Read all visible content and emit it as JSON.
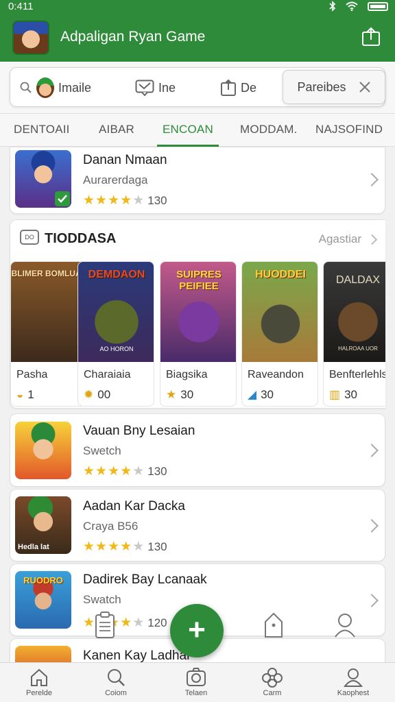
{
  "status": {
    "time": "0:411"
  },
  "header": {
    "title": "Adpaligan Ryan Game"
  },
  "filters": [
    {
      "label": "Imaile"
    },
    {
      "label": "Ine"
    },
    {
      "label": "De"
    },
    {
      "label": "Pareibes"
    }
  ],
  "tabs": [
    {
      "label": "DENTOAII",
      "active": false
    },
    {
      "label": "AIBAR",
      "active": false
    },
    {
      "label": "ENCOAN",
      "active": true
    },
    {
      "label": "MODDAM.",
      "active": false
    },
    {
      "label": "NAJSOFIND",
      "active": false
    }
  ],
  "top_game": {
    "name": "Danan Nmaan",
    "subtitle": "Aurarerdaga",
    "rating": 4,
    "count": "130"
  },
  "section": {
    "icon_text": "DO",
    "title": "TIODDASA",
    "link": "Agastiar",
    "tiles": [
      {
        "art_title": "BLIMER BOMLUAD",
        "caption": "Pasha",
        "score": "1",
        "icon": "lamp-icon"
      },
      {
        "art_title": "DEMDAON",
        "badge_text": "AO HORON",
        "caption": "Charaiaia",
        "score": "00",
        "icon": "sun-icon"
      },
      {
        "art_title": "SUIPRES PEIFIEE",
        "caption": "Biagsika",
        "score": "30",
        "icon": "star-icon"
      },
      {
        "art_title": "HUODDEI",
        "caption": "Raveandon",
        "score": "30",
        "icon": "bolt-icon"
      },
      {
        "art_title": "DALDAX",
        "badge_text": "HALROAA UOR",
        "caption": "Benfterlehls",
        "score": "30",
        "icon": "bars-icon"
      }
    ]
  },
  "games": [
    {
      "name": "Vauan Bny Lesaian",
      "subtitle": "Swetch",
      "rating": 4,
      "count": "130"
    },
    {
      "name": "Aadan Kar Dacka",
      "subtitle": "Craya B56",
      "rating": 4,
      "count": "130",
      "art_text": "Hedla lat"
    },
    {
      "name": "Dadirek Bay Lcanaak",
      "subtitle": "Swatch",
      "rating": 4,
      "count": "120",
      "art_text": "RUODRO"
    },
    {
      "name": "Kanen Kay Ladhar"
    }
  ],
  "fab": {
    "label": "+"
  },
  "bottom_nav": [
    {
      "label": "Perelde",
      "icon": "home-icon"
    },
    {
      "label": "Coiom",
      "icon": "search-icon"
    },
    {
      "label": "Telaen",
      "icon": "camera-icon"
    },
    {
      "label": "Carm",
      "icon": "flower-icon"
    },
    {
      "label": "Kaophest",
      "icon": "profile-icon"
    }
  ],
  "colors": {
    "brand": "#2e8b3a",
    "star": "#f1b81a"
  }
}
